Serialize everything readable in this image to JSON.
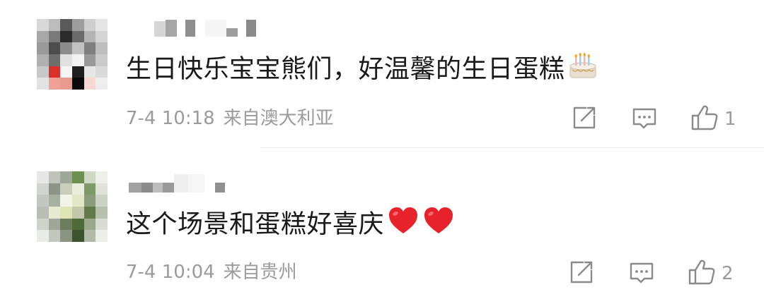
{
  "comments": [
    {
      "text": "生日快乐宝宝熊们，好温馨的生日蛋糕",
      "emoji": "cake-emoji",
      "date": "7-4 10:18",
      "location": "来自澳大利亚",
      "likes": "1"
    },
    {
      "text": "这个场景和蛋糕好喜庆",
      "emoji": "heart-emoji",
      "date": "7-4 10:04",
      "location": "来自贵州",
      "likes": "2"
    }
  ],
  "icons": {
    "share": "share-icon",
    "reply": "comment-icon",
    "like": "thumbs-up-icon"
  },
  "colors": {
    "text": "#1a1a1a",
    "meta": "#9b9b9b",
    "icon": "#8a8a8a",
    "heart": "#e8222b"
  }
}
